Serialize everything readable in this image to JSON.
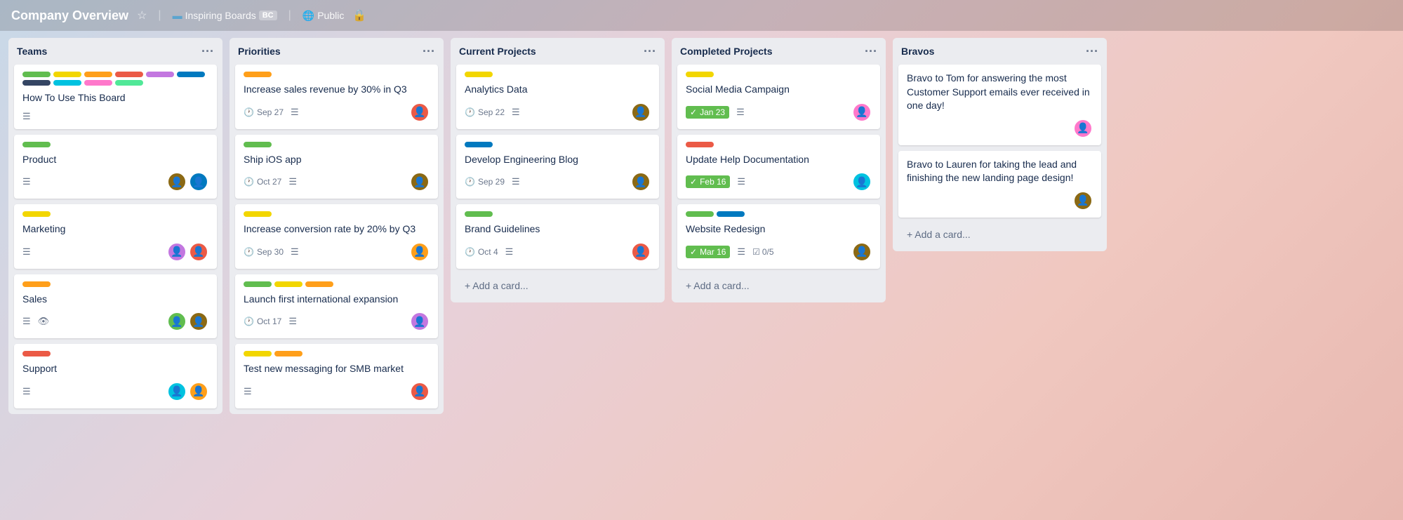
{
  "header": {
    "title": "Company Overview",
    "star_label": "★",
    "board_icon": "▬",
    "workspace": "Inspiring Boards",
    "workspace_badge": "BC",
    "visibility": "Public",
    "lock_icon": "🔒"
  },
  "columns": [
    {
      "id": "teams",
      "title": "Teams",
      "cards": [
        {
          "id": "how-to-use",
          "labels": [
            "green",
            "yellow",
            "orange",
            "red",
            "purple",
            "blue",
            "dark",
            "teal",
            "pink",
            "lime"
          ],
          "title": "How To Use This Board",
          "has_desc": true,
          "avatars": []
        },
        {
          "id": "product",
          "labels": [
            "green"
          ],
          "title": "Product",
          "has_desc": true,
          "avatars": [
            "av-brown",
            "av-blue"
          ]
        },
        {
          "id": "marketing",
          "labels": [
            "yellow"
          ],
          "title": "Marketing",
          "has_desc": true,
          "avatars": [
            "av-purple",
            "av-red"
          ]
        },
        {
          "id": "sales",
          "labels": [
            "orange"
          ],
          "title": "Sales",
          "has_eye": true,
          "has_desc": true,
          "avatars": [
            "av-green",
            "av-brown"
          ]
        },
        {
          "id": "support",
          "labels": [
            "red"
          ],
          "title": "Support",
          "has_desc": true,
          "avatars": [
            "av-teal",
            "av-orange"
          ]
        }
      ]
    },
    {
      "id": "priorities",
      "title": "Priorities",
      "cards": [
        {
          "id": "increase-sales",
          "labels": [
            "orange"
          ],
          "title": "Increase sales revenue by 30% in Q3",
          "date": "Sep 27",
          "has_desc": true,
          "avatars": [
            "av-red"
          ]
        },
        {
          "id": "ship-ios",
          "labels": [
            "green"
          ],
          "title": "Ship iOS app",
          "date": "Oct 27",
          "has_desc": true,
          "avatars": [
            "av-brown"
          ]
        },
        {
          "id": "increase-conversion",
          "labels": [
            "yellow"
          ],
          "title": "Increase conversion rate by 20% by Q3",
          "date": "Sep 30",
          "has_desc": true,
          "avatars": [
            "av-orange"
          ]
        },
        {
          "id": "launch-international",
          "labels": [
            "green",
            "yellow",
            "orange"
          ],
          "title": "Launch first international expansion",
          "date": "Oct 17",
          "has_desc": true,
          "avatars": [
            "av-purple"
          ]
        },
        {
          "id": "test-messaging",
          "labels": [
            "yellow",
            "orange"
          ],
          "title": "Test new messaging for SMB market",
          "has_desc": true,
          "avatars": [
            "av-red"
          ]
        }
      ]
    },
    {
      "id": "current-projects",
      "title": "Current Projects",
      "cards": [
        {
          "id": "analytics-data",
          "labels": [
            "yellow"
          ],
          "title": "Analytics Data",
          "date": "Sep 22",
          "has_desc": true,
          "avatars": [
            "av-brown"
          ]
        },
        {
          "id": "develop-engineering-blog",
          "labels": [
            "blue"
          ],
          "title": "Develop Engineering Blog",
          "date": "Sep 29",
          "has_desc": true,
          "avatars": [
            "av-brown"
          ]
        },
        {
          "id": "brand-guidelines",
          "labels": [
            "green"
          ],
          "title": "Brand Guidelines",
          "date": "Oct 4",
          "has_desc": true,
          "avatars": [
            "av-red"
          ]
        }
      ],
      "add_card_label": "Add a card..."
    },
    {
      "id": "completed-projects",
      "title": "Completed Projects",
      "cards": [
        {
          "id": "social-media-campaign",
          "labels": [
            "yellow"
          ],
          "title": "Social Media Campaign",
          "date_done": "Jan 23",
          "has_desc": true,
          "avatars": [
            "av-pink"
          ]
        },
        {
          "id": "update-help-docs",
          "labels": [
            "red"
          ],
          "title": "Update Help Documentation",
          "date_done": "Feb 16",
          "has_desc": true,
          "avatars": [
            "av-teal"
          ]
        },
        {
          "id": "website-redesign",
          "labels": [
            "green",
            "blue"
          ],
          "title": "Website Redesign",
          "date_done": "Mar 16",
          "has_desc": true,
          "checklist": "0/5",
          "avatars": [
            "av-brown"
          ]
        }
      ],
      "add_card_label": "Add a card..."
    },
    {
      "id": "bravos",
      "title": "Bravos",
      "bravos": [
        {
          "id": "bravo-tom",
          "text": "Bravo to Tom for answering the most Customer Support emails ever received in one day!",
          "avatar": "av-pink"
        },
        {
          "id": "bravo-lauren",
          "text": "Bravo to Lauren for taking the lead and finishing the new landing page design!",
          "avatar": "av-brown"
        }
      ],
      "add_card_label": "Add a card..."
    }
  ]
}
